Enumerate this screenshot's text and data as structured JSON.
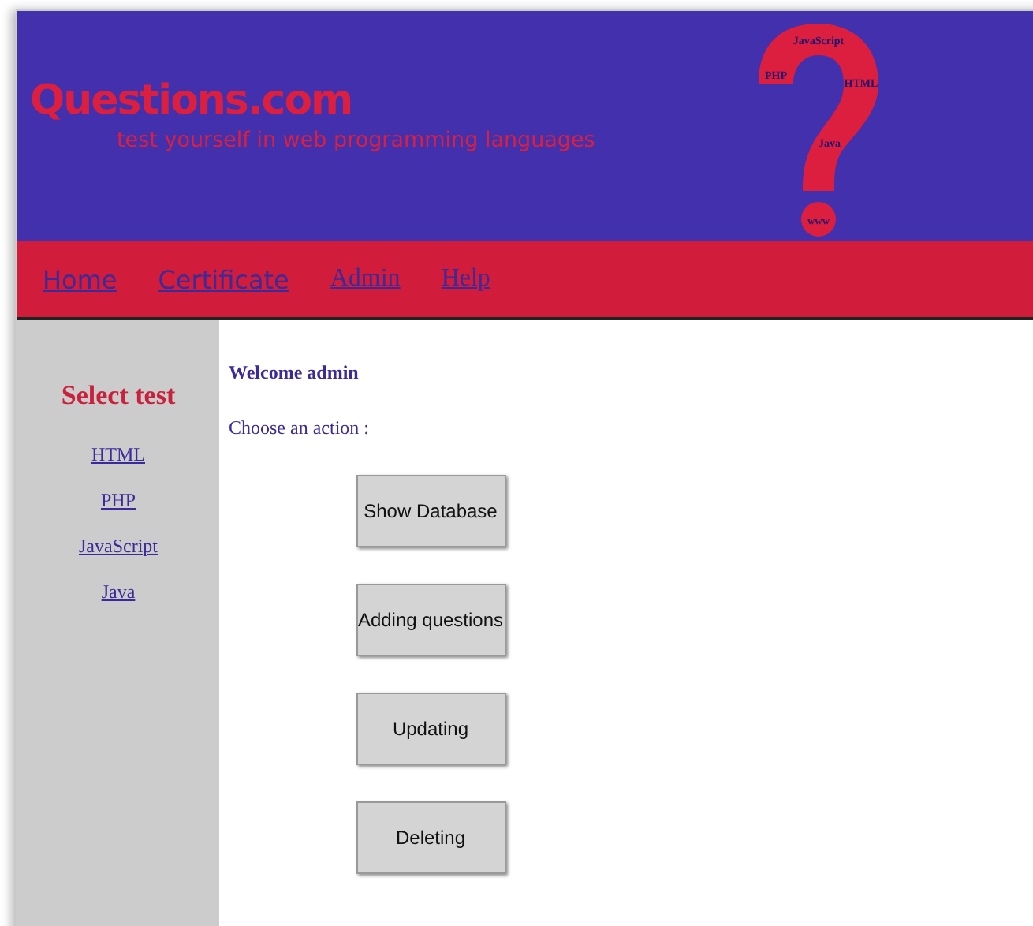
{
  "header": {
    "logo": "Questions.com",
    "tagline": "test yourself in web programming languages",
    "emblem_words": [
      "JavaScript",
      "PHP",
      "HTML",
      "Java",
      "www"
    ]
  },
  "nav": [
    {
      "label": "Home"
    },
    {
      "label": "Certificate"
    },
    {
      "label": "Admin"
    },
    {
      "label": "Help"
    }
  ],
  "sidebar": {
    "title": "Select test",
    "links": [
      "HTML",
      "PHP",
      "JavaScript",
      "Java"
    ]
  },
  "main": {
    "welcome": "Welcome admin",
    "prompt": "Choose an action :",
    "buttons": [
      "Show Database",
      "Adding questions",
      "Updating",
      "Deleting"
    ]
  }
}
